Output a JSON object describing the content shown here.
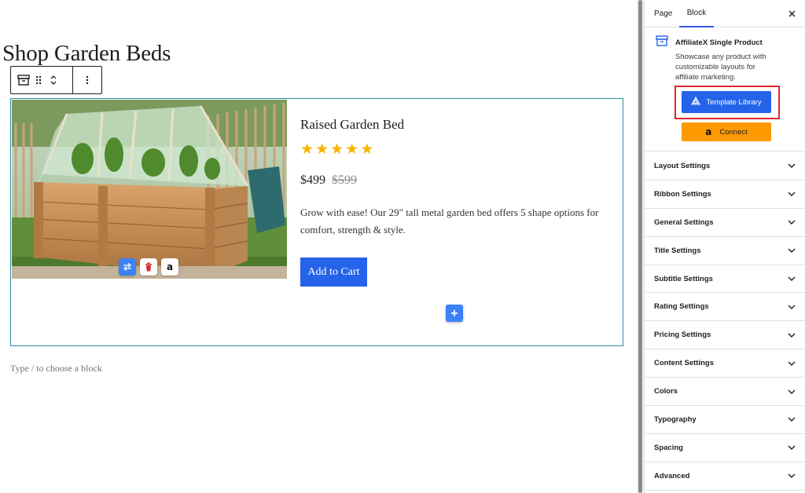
{
  "editor": {
    "page_title": "Shop Garden Beds",
    "hint": "Type / to choose a block"
  },
  "product": {
    "title": "Raised Garden Bed",
    "rating": 5,
    "rating_max": 5,
    "price": "$499",
    "price_old": "$599",
    "description": "Grow with ease! Our 29\" tall metal garden bed offers 5 shape options for comfort, strength & style.",
    "cart_label": "Add to Cart"
  },
  "sidebar": {
    "tabs": [
      "Page",
      "Block"
    ],
    "active_tab": "Block",
    "block_title": "AffiliateX Single Product",
    "block_description": "Showcase any product with customizable layouts for affiliate marketing.",
    "template_button": "Template Library",
    "connect_button": "Connect",
    "panels": [
      "Layout Settings",
      "Ribbon Settings",
      "General Settings",
      "Title Settings",
      "Subtitle Settings",
      "Rating Settings",
      "Pricing Settings",
      "Content Settings",
      "Colors",
      "Typography",
      "Spacing",
      "Advanced"
    ]
  },
  "colors": {
    "accent": "#2563eb",
    "block_border": "#2b8ca1",
    "star": "#f5b400",
    "amazon": "#ff9900",
    "highlight": "#e0262f"
  },
  "icons": {
    "block": "archive-box-icon",
    "drag": "drag-handle-icon",
    "move": "chevron-up-down-icon",
    "more": "vertical-ellipsis-icon",
    "swap": "swap-arrows-icon",
    "delete": "trash-icon",
    "amazon": "amazon-logo-icon",
    "add": "plus-icon",
    "close": "close-icon",
    "template": "triangle-logo-icon",
    "chevron": "chevron-down-icon"
  }
}
